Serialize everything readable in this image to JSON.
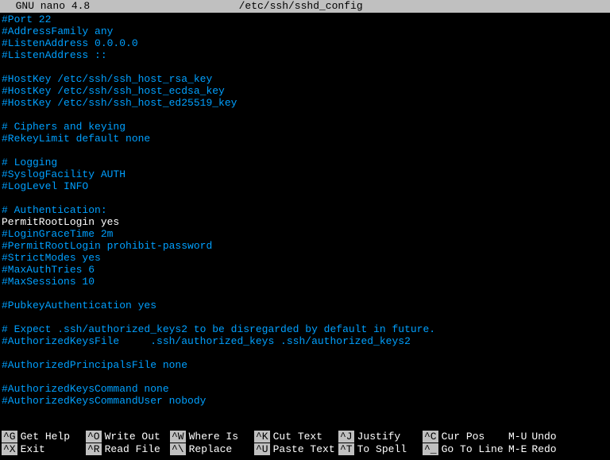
{
  "title_bar": {
    "app": "  GNU nano 4.8",
    "filename": "/etc/ssh/sshd_config"
  },
  "lines": [
    {
      "t": "comment",
      "v": "#Port 22"
    },
    {
      "t": "comment",
      "v": "#AddressFamily any"
    },
    {
      "t": "comment",
      "v": "#ListenAddress 0.0.0.0"
    },
    {
      "t": "comment",
      "v": "#ListenAddress ::"
    },
    {
      "t": "blank",
      "v": ""
    },
    {
      "t": "comment",
      "v": "#HostKey /etc/ssh/ssh_host_rsa_key"
    },
    {
      "t": "comment",
      "v": "#HostKey /etc/ssh/ssh_host_ecdsa_key"
    },
    {
      "t": "comment",
      "v": "#HostKey /etc/ssh/ssh_host_ed25519_key"
    },
    {
      "t": "blank",
      "v": ""
    },
    {
      "t": "comment",
      "v": "# Ciphers and keying"
    },
    {
      "t": "comment",
      "v": "#RekeyLimit default none"
    },
    {
      "t": "blank",
      "v": ""
    },
    {
      "t": "comment",
      "v": "# Logging"
    },
    {
      "t": "comment",
      "v": "#SyslogFacility AUTH"
    },
    {
      "t": "comment",
      "v": "#LogLevel INFO"
    },
    {
      "t": "blank",
      "v": ""
    },
    {
      "t": "comment",
      "v": "# Authentication:"
    },
    {
      "t": "setting",
      "v": "PermitRootLogin yes"
    },
    {
      "t": "comment",
      "v": "#LoginGraceTime 2m"
    },
    {
      "t": "comment",
      "v": "#PermitRootLogin prohibit-password"
    },
    {
      "t": "comment",
      "v": "#StrictModes yes"
    },
    {
      "t": "comment",
      "v": "#MaxAuthTries 6"
    },
    {
      "t": "comment",
      "v": "#MaxSessions 10"
    },
    {
      "t": "blank",
      "v": ""
    },
    {
      "t": "comment",
      "v": "#PubkeyAuthentication yes"
    },
    {
      "t": "blank",
      "v": ""
    },
    {
      "t": "comment",
      "v": "# Expect .ssh/authorized_keys2 to be disregarded by default in future."
    },
    {
      "t": "comment",
      "v": "#AuthorizedKeysFile     .ssh/authorized_keys .ssh/authorized_keys2"
    },
    {
      "t": "blank",
      "v": ""
    },
    {
      "t": "comment",
      "v": "#AuthorizedPrincipalsFile none"
    },
    {
      "t": "blank",
      "v": ""
    },
    {
      "t": "comment",
      "v": "#AuthorizedKeysCommand none"
    },
    {
      "t": "comment",
      "v": "#AuthorizedKeysCommandUser nobody"
    }
  ],
  "shortcuts": {
    "row1": [
      {
        "key": "^G",
        "label": "Get Help",
        "inv": true
      },
      {
        "key": "^O",
        "label": "Write Out",
        "inv": true
      },
      {
        "key": "^W",
        "label": "Where Is",
        "inv": true
      },
      {
        "key": "^K",
        "label": "Cut Text",
        "inv": true
      },
      {
        "key": "^J",
        "label": "Justify",
        "inv": true
      },
      {
        "key": "^C",
        "label": "Cur Pos",
        "inv": true
      },
      {
        "key": "M-U",
        "label": "Undo",
        "inv": false
      }
    ],
    "row2": [
      {
        "key": "^X",
        "label": "Exit",
        "inv": true
      },
      {
        "key": "^R",
        "label": "Read File",
        "inv": true
      },
      {
        "key": "^\\",
        "label": "Replace",
        "inv": true
      },
      {
        "key": "^U",
        "label": "Paste Text",
        "inv": true
      },
      {
        "key": "^T",
        "label": "To Spell",
        "inv": true
      },
      {
        "key": "^_",
        "label": "Go To Line",
        "inv": true
      },
      {
        "key": "M-E",
        "label": "Redo",
        "inv": false
      }
    ]
  }
}
